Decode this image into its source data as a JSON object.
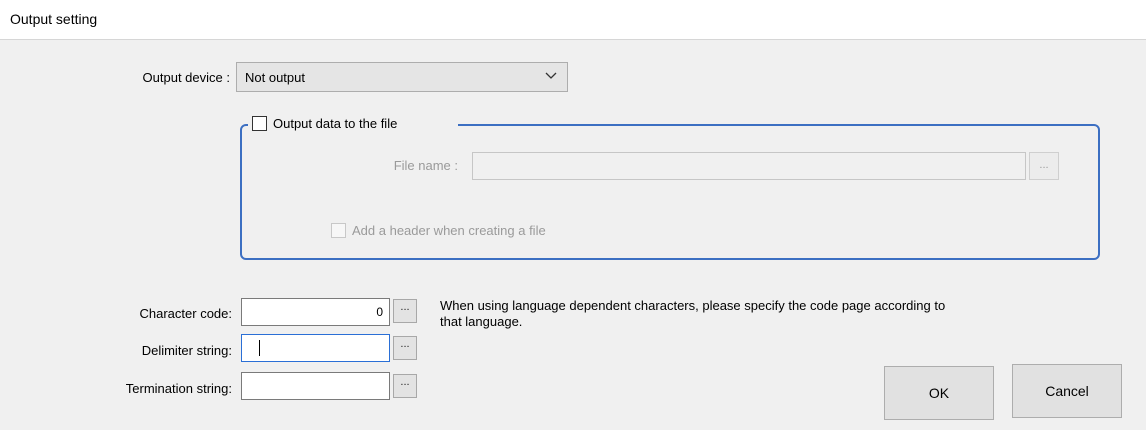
{
  "window": {
    "title": "Output setting"
  },
  "output_device": {
    "label": "Output device :",
    "selected": "Not output"
  },
  "file_group": {
    "checkbox_label": "Output data to the file",
    "checked": false,
    "file_name_label": "File name :",
    "file_name_value": "",
    "browse_label": "...",
    "header_checkbox_label": "Add a header when creating a file",
    "header_checked": false
  },
  "character_code": {
    "label": "Character code:",
    "value": "0",
    "button_label": "..."
  },
  "delimiter": {
    "label": "Delimiter string:",
    "value": "",
    "button_label": "..."
  },
  "termination": {
    "label": "Termination string:",
    "value": "",
    "button_label": "..."
  },
  "note": {
    "line1": "When using language dependent characters, please specify the code page according to",
    "line2": "that language."
  },
  "buttons": {
    "ok": "OK",
    "cancel": "Cancel"
  },
  "colors": {
    "group_border": "#3c6fc2",
    "focus_border": "#2a6fd6",
    "background": "#f0f0f0"
  }
}
